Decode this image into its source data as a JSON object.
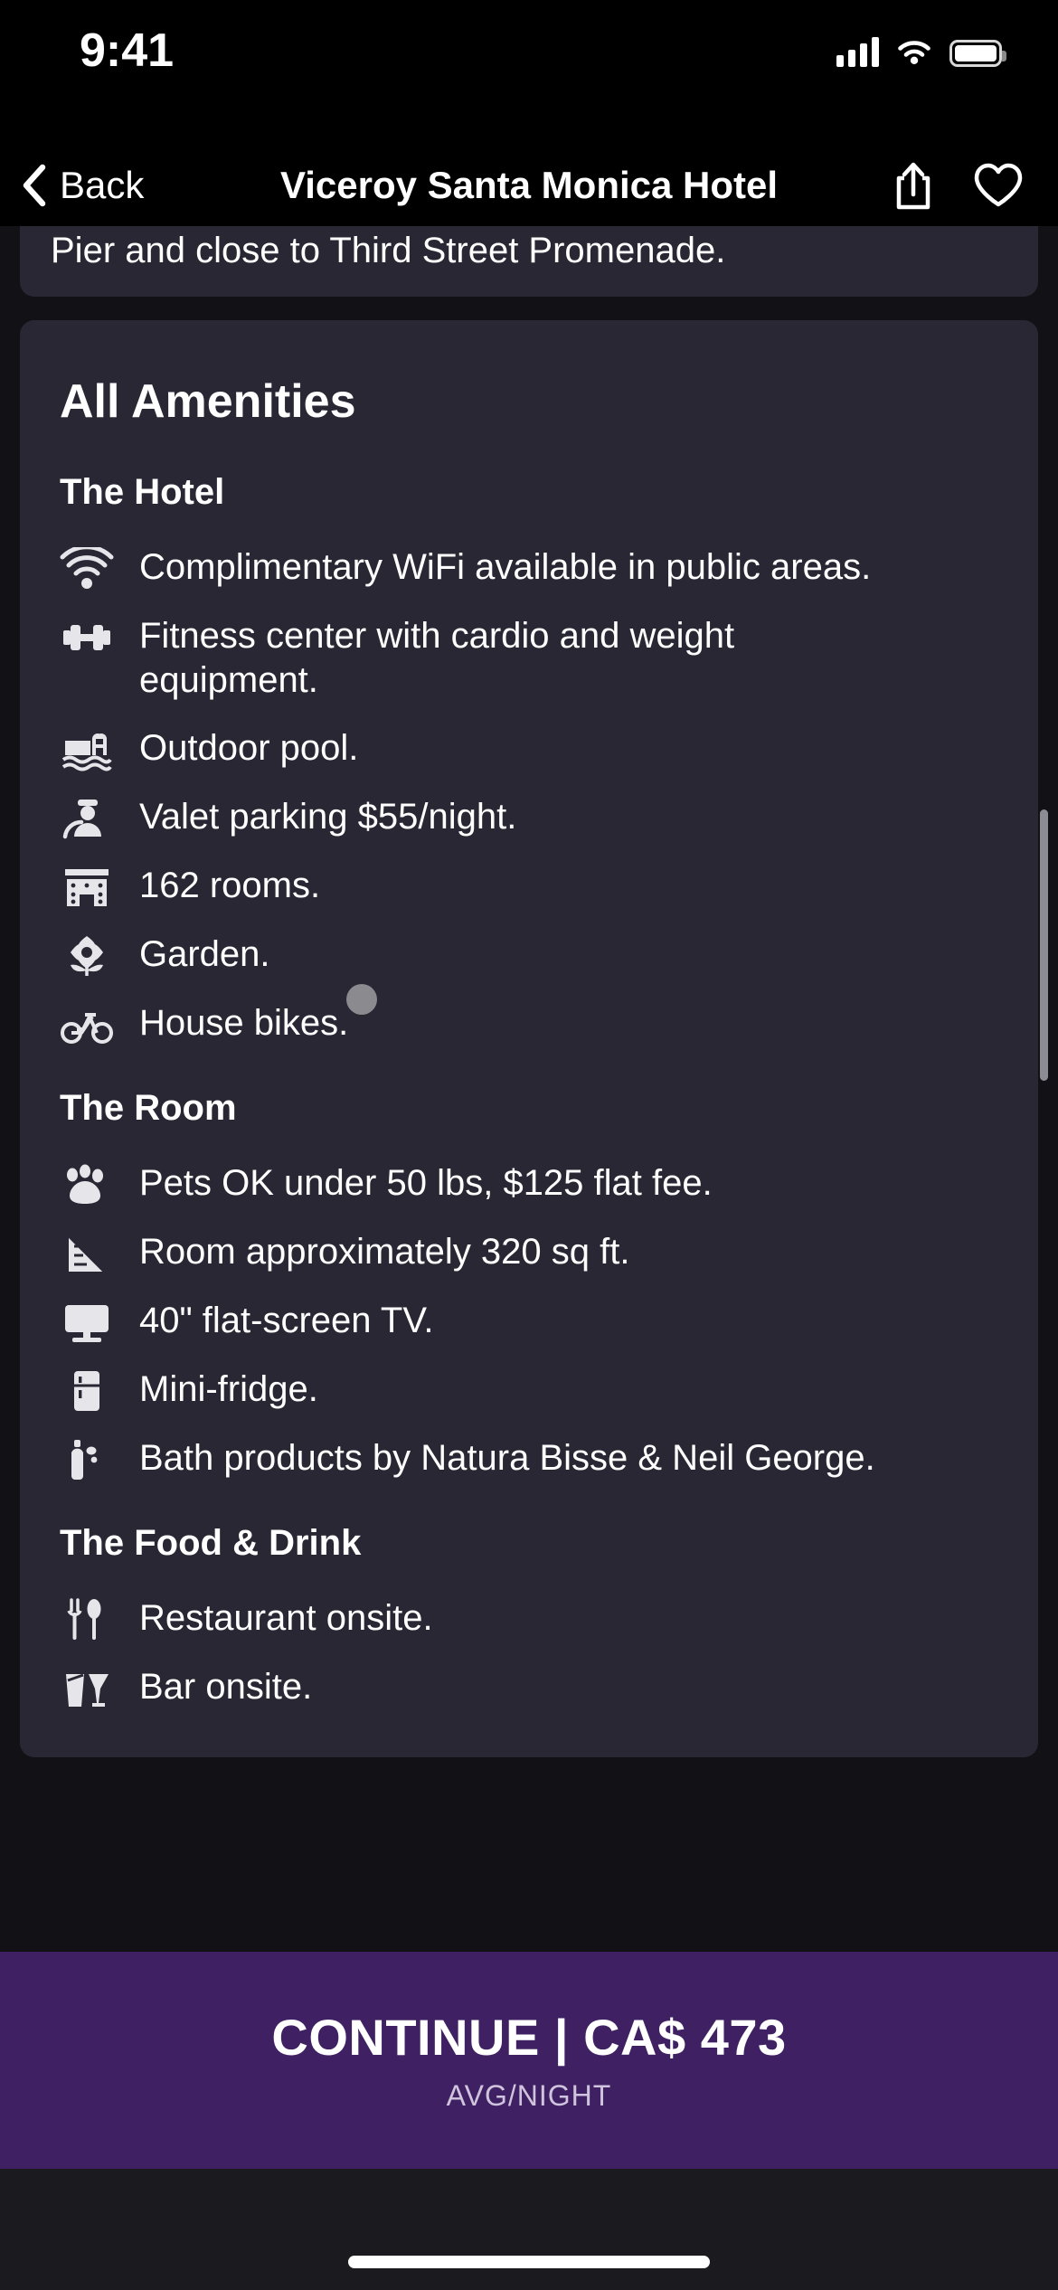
{
  "status_bar": {
    "time": "9:41",
    "cellular_icon": "cellular-signal-icon",
    "wifi_icon": "wifi-icon",
    "battery_icon": "battery-full-icon"
  },
  "navbar": {
    "back_label": "Back",
    "back_icon": "chevron-left-icon",
    "title": "Viceroy Santa Monica Hotel",
    "share_icon": "share-icon",
    "favorite_icon": "heart-outline-icon"
  },
  "description_card": {
    "clipped_text": "Pier and close to Third Street Promenade."
  },
  "amenities": {
    "title": "All Amenities",
    "groups": [
      {
        "title": "The Hotel",
        "items": [
          {
            "icon": "wifi-icon",
            "text": "Complimentary WiFi available in public areas."
          },
          {
            "icon": "dumbbell-icon",
            "text": "Fitness center with cardio and weight equipment."
          },
          {
            "icon": "pool-icon",
            "text": "Outdoor pool."
          },
          {
            "icon": "valet-parking-icon",
            "text": "Valet parking $55/night."
          },
          {
            "icon": "hotel-building-icon",
            "text": "162 rooms."
          },
          {
            "icon": "flower-garden-icon",
            "text": "Garden."
          },
          {
            "icon": "bicycle-icon",
            "text": "House bikes."
          }
        ]
      },
      {
        "title": "The Room",
        "items": [
          {
            "icon": "paw-print-icon",
            "text": "Pets OK under 50 lbs, $125 flat fee."
          },
          {
            "icon": "ruler-measure-icon",
            "text": "Room approximately 320 sq ft."
          },
          {
            "icon": "television-icon",
            "text": "40\" flat-screen TV."
          },
          {
            "icon": "mini-fridge-icon",
            "text": "Mini-fridge."
          },
          {
            "icon": "bath-products-icon",
            "text": "Bath products by Natura Bisse & Neil George."
          }
        ]
      },
      {
        "title": "The Food & Drink",
        "items": [
          {
            "icon": "fork-spoon-icon",
            "text": "Restaurant onsite."
          },
          {
            "icon": "drinks-bar-icon",
            "text": "Bar onsite."
          }
        ]
      }
    ]
  },
  "cta": {
    "main_label": "CONTINUE | CA$ 473",
    "sub_label": "AVG/NIGHT",
    "background_color": "#3e2063"
  },
  "colors": {
    "page_background": "#121216",
    "card_background": "#282733",
    "text_primary": "#ffffff",
    "accent_purple": "#3e2063"
  }
}
